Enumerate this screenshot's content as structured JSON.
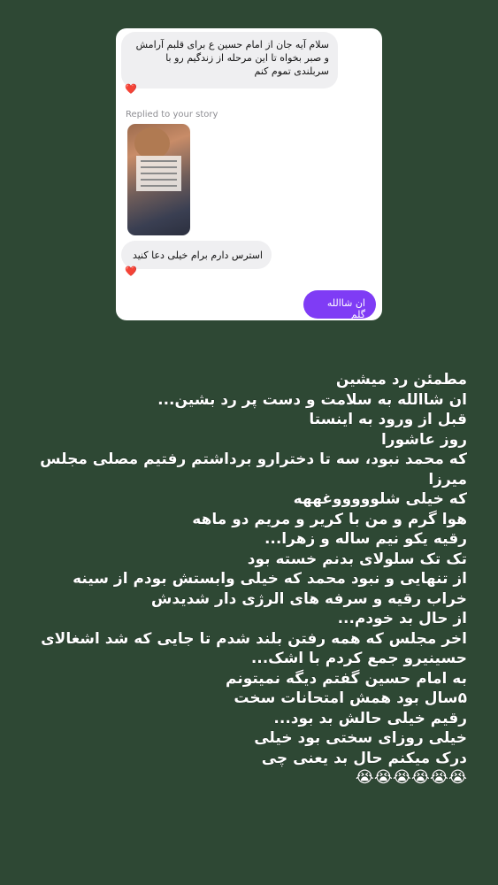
{
  "dm_card": {
    "incoming_message_1": "سلام آیه جان از امام حسین ع برای قلبم آرامش و صبر بخواه تا این مرحله  از زندگیم رو با سربلندی تموم کنم",
    "reaction_1": "❤️",
    "replied_label": "Replied to your story",
    "incoming_message_2": "استرس دارم برام خیلی دعا کنید",
    "reaction_2": "❤️",
    "outgoing_message": "ان شاالله گلم"
  },
  "story_lines": [
    "مطمئن رد میشین",
    "ان شاالله به سلامت و دست پر رد بشین...",
    "قبل از ورود به اینستا",
    "روز عاشورا",
    "که محمد نبود، سه تا دخترارو برداشتم رفتیم مصلی مجلس",
    "میرزا",
    "که خیلی شلوووووغههه",
    "هوا گرم و من با کریر و مریم دو ماهه",
    "رقیه یکو نیم ساله و زهرا...",
    "تک تک سلولای بدنم خسته بود",
    "از تنهایی و نبود محمد که خیلی وابستش بودم از سینه",
    "خراب رقیه و سرفه های الرژی دار شدیدش",
    "از حال بد خودم...",
    "اخر مجلس که همه رفتن بلند شدم تا جایی که شد اشغالای",
    "حسینیرو جمع کردم با اشک...",
    "به امام حسین گفتم دیگه نمیتونم",
    "۵سال بود همش امتحانات سخت",
    "رقیم خیلی حالش بد بود...",
    "خیلی روزای سختی بود خیلی",
    "درک میکنم حال بد یعنی چی"
  ],
  "emoji_line": "😭😭😭😭😭😭"
}
